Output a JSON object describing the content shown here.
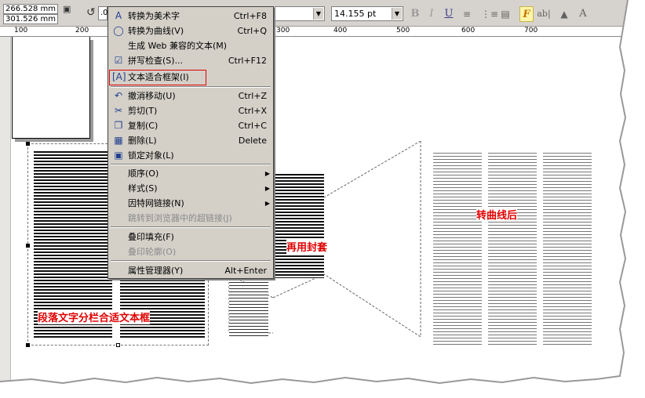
{
  "toolbar": {
    "x_pos": "266.528 mm",
    "y_pos": "301.526 mm",
    "angle": ".0",
    "font_size": "14.155 pt",
    "bold_label": "B",
    "italic_label": "I",
    "underline_label": "U",
    "charfmt_label": "F",
    "frame_label": "ab|",
    "vertical_label": "A"
  },
  "ruler": {
    "labels": [
      "100",
      "200",
      "300",
      "400",
      "500",
      "600",
      "700"
    ]
  },
  "menu": {
    "items": [
      {
        "label": "转换为美术字",
        "shortcut": "Ctrl+F8",
        "icon": "artistic-text-icon"
      },
      {
        "label": "转换为曲线(V)",
        "shortcut": "Ctrl+Q",
        "icon": "convert-curves-icon"
      },
      {
        "label": "生成 Web 兼容的文本(M)",
        "shortcut": "",
        "icon": ""
      },
      {
        "label": "拼写检查(S)...",
        "shortcut": "Ctrl+F12",
        "icon": "spellcheck-icon"
      },
      {
        "label": "文本适合框架(I)",
        "shortcut": "",
        "icon": "fit-text-frame-icon"
      },
      {
        "label": "撤消移动(U)",
        "shortcut": "Ctrl+Z",
        "icon": "undo-icon"
      },
      {
        "label": "剪切(T)",
        "shortcut": "Ctrl+X",
        "icon": "cut-icon"
      },
      {
        "label": "复制(C)",
        "shortcut": "Ctrl+C",
        "icon": "copy-icon"
      },
      {
        "label": "删除(L)",
        "shortcut": "Delete",
        "icon": "delete-icon"
      },
      {
        "label": "锁定对象(L)",
        "shortcut": "",
        "icon": "lock-icon"
      },
      {
        "label": "顺序(O)",
        "shortcut": "",
        "icon": ""
      },
      {
        "label": "样式(S)",
        "shortcut": "",
        "icon": ""
      },
      {
        "label": "因特网链接(N)",
        "shortcut": "",
        "icon": ""
      },
      {
        "label": "跳转到浏览器中的超链接(J)",
        "shortcut": "",
        "icon": ""
      },
      {
        "label": "叠印填充(F)",
        "shortcut": "",
        "icon": ""
      },
      {
        "label": "叠印轮廓(O)",
        "shortcut": "",
        "icon": ""
      },
      {
        "label": "属性管理器(Y)",
        "shortcut": "Alt+Enter",
        "icon": ""
      }
    ]
  },
  "annotations": {
    "left": "段落文字分栏合适文本框",
    "middle": "再用封套",
    "right": "转曲线后"
  }
}
